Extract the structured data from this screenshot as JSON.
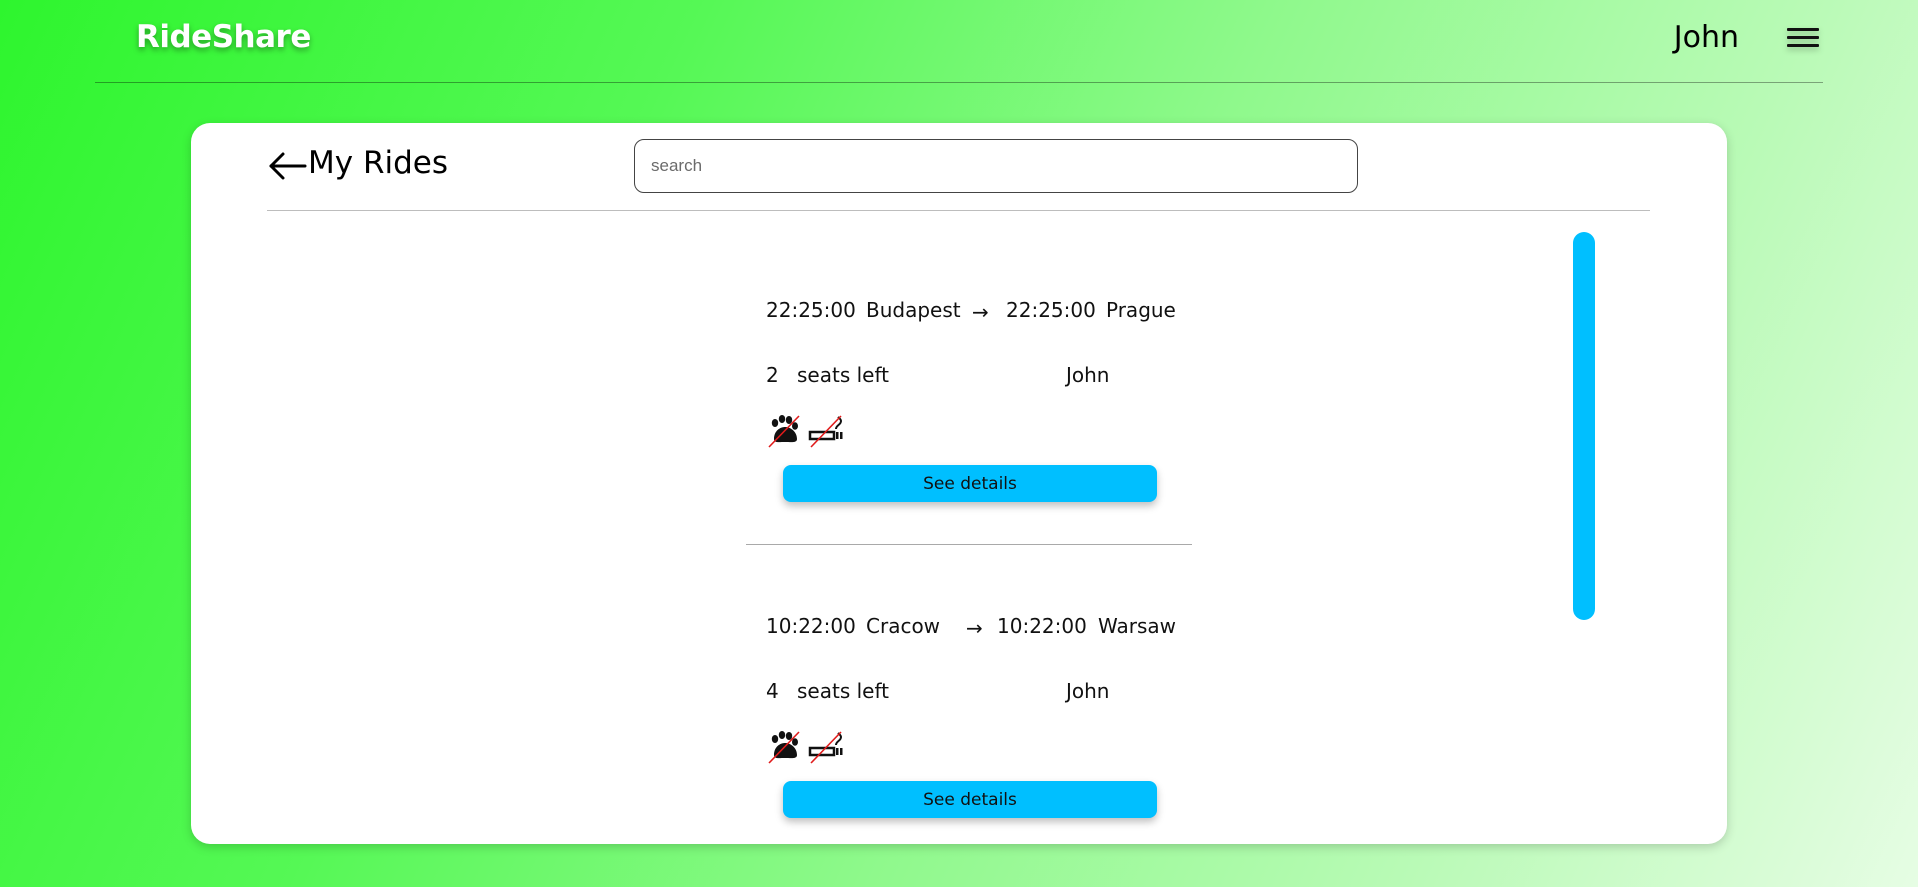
{
  "header": {
    "logo": "RideShare",
    "user_name": "John",
    "menu_icon": "hamburger-menu-icon"
  },
  "panel": {
    "title": "My Rides",
    "back_icon": "arrow-left-icon",
    "search": {
      "placeholder": "search",
      "value": ""
    }
  },
  "rides": [
    {
      "departure_time": "22:25:00",
      "departure_city": "Budapest",
      "arrival_time": "22:25:00",
      "arrival_city": "Prague",
      "seats_left": "2",
      "seats_label": "seats left",
      "driver": "John",
      "icons": [
        "no-pets-icon",
        "no-smoking-icon"
      ],
      "details_label": "See details"
    },
    {
      "departure_time": "10:22:00",
      "departure_city": "Cracow",
      "arrival_time": "10:22:00",
      "arrival_city": "Warsaw",
      "seats_left": "4",
      "seats_label": "seats left",
      "driver": "John",
      "icons": [
        "no-pets-icon",
        "no-smoking-icon"
      ],
      "details_label": "See details"
    }
  ],
  "colors": {
    "accent": "#00bfff",
    "background_start": "#2ef52e",
    "background_end": "#e6fde4",
    "panel": "#ffffff",
    "strike": "#e01b1b"
  }
}
